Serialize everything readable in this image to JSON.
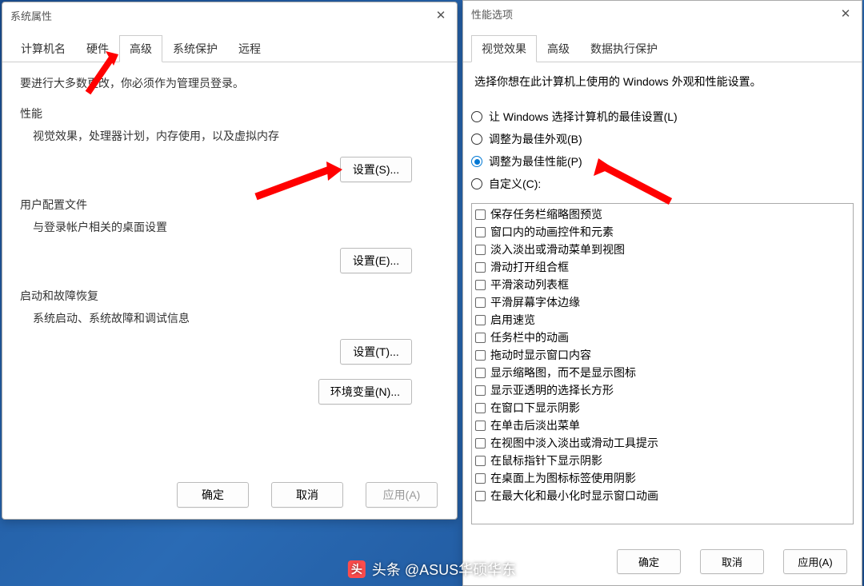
{
  "dialog1": {
    "title": "系统属性",
    "tabs": [
      "计算机名",
      "硬件",
      "高级",
      "系统保护",
      "远程"
    ],
    "active_tab_index": 2,
    "intro": "要进行大多数更改，你必须作为管理员登录。",
    "groups": {
      "perf": {
        "title": "性能",
        "desc": "视觉效果，处理器计划，内存使用，以及虚拟内存",
        "btn": "设置(S)..."
      },
      "profile": {
        "title": "用户配置文件",
        "desc": "与登录帐户相关的桌面设置",
        "btn": "设置(E)..."
      },
      "startup": {
        "title": "启动和故障恢复",
        "desc": "系统启动、系统故障和调试信息",
        "btn": "设置(T)..."
      }
    },
    "env_btn": "环境变量(N)...",
    "footer": {
      "ok": "确定",
      "cancel": "取消",
      "apply": "应用(A)"
    }
  },
  "dialog2": {
    "title": "性能选项",
    "tabs": [
      "视觉效果",
      "高级",
      "数据执行保护"
    ],
    "active_tab_index": 0,
    "desc": "选择你想在此计算机上使用的 Windows 外观和性能设置。",
    "radios": [
      "让 Windows 选择计算机的最佳设置(L)",
      "调整为最佳外观(B)",
      "调整为最佳性能(P)",
      "自定义(C):"
    ],
    "selected_radio": 2,
    "checks": [
      "保存任务栏缩略图预览",
      "窗口内的动画控件和元素",
      "淡入淡出或滑动菜单到视图",
      "滑动打开组合框",
      "平滑滚动列表框",
      "平滑屏幕字体边缘",
      "启用速览",
      "任务栏中的动画",
      "拖动时显示窗口内容",
      "显示缩略图，而不是显示图标",
      "显示亚透明的选择长方形",
      "在窗口下显示阴影",
      "在单击后淡出菜单",
      "在视图中淡入淡出或滑动工具提示",
      "在鼠标指针下显示阴影",
      "在桌面上为图标标签使用阴影",
      "在最大化和最小化时显示窗口动画"
    ],
    "footer": {
      "ok": "确定",
      "cancel": "取消",
      "apply": "应用(A)"
    }
  },
  "watermark": "头条 @ASUS华硕华东"
}
